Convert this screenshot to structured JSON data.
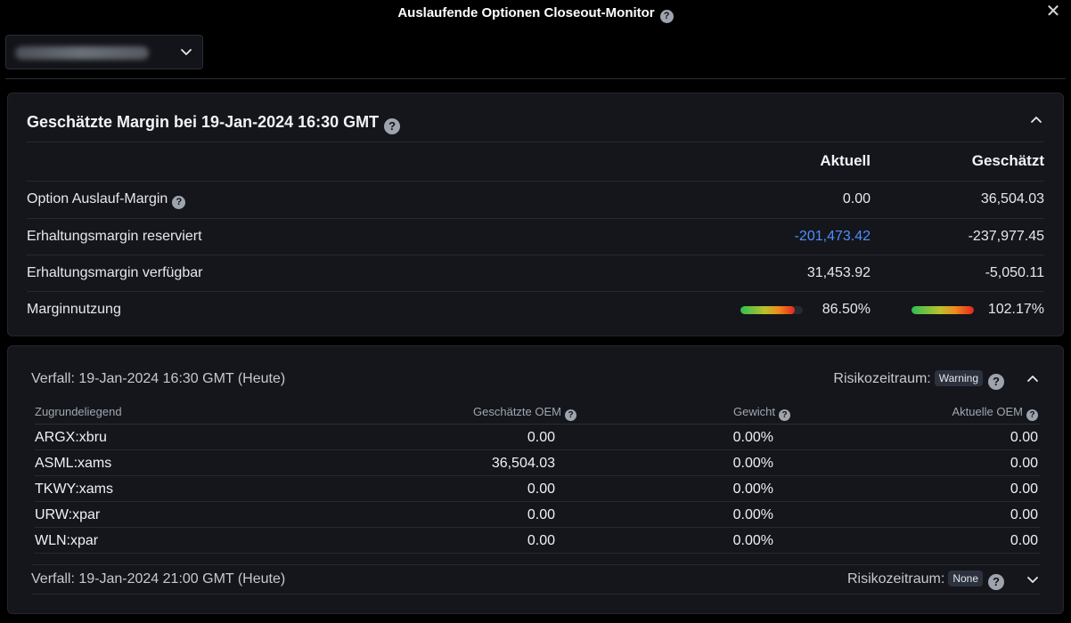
{
  "window": {
    "title": "Auslaufende Optionen Closeout-Monitor",
    "help_glyph": "?",
    "close_glyph": "✕"
  },
  "account_select": {
    "value": "",
    "icon": "chevron-down-icon"
  },
  "margin_panel": {
    "title": "Geschätzte Margin bei 19-Jan-2024 16:30 GMT",
    "columns": {
      "current": "Aktuell",
      "estimated": "Geschätzt"
    },
    "rows": [
      {
        "label": "Option Auslauf-Margin",
        "current": "0.00",
        "estimated": "36,504.03"
      },
      {
        "label": "Erhaltungsmargin reserviert",
        "current": "-201,473.42",
        "estimated": "-237,977.45"
      },
      {
        "label": "Erhaltungsmargin verfügbar",
        "current": "31,453.92",
        "estimated": "-5,050.11"
      },
      {
        "label": "Marginnutzung",
        "current": "86.50%",
        "estimated": "102.17%"
      }
    ],
    "utilization": {
      "current_fraction": 0.865,
      "estimated_fraction": 1.0
    },
    "colors": {
      "negative_highlight": "#4f8dff",
      "bar_start": "#2fbf52",
      "bar_end": "#e4261f"
    }
  },
  "expiry_panel": {
    "expiry1": {
      "title": "Verfall: 19-Jan-2024 16:30 GMT (Heute)",
      "risk_label": "Risikozeitraum:",
      "risk_badge": "Warning",
      "headers": {
        "underlying": "Zugrundeliegend",
        "est_oem": "Geschätzte OEM",
        "weight": "Gewicht",
        "current_oem": "Aktuelle OEM"
      },
      "rows": [
        {
          "underlying": "ARGX:xbru",
          "est_oem": "0.00",
          "weight": "0.00%",
          "current_oem": "0.00"
        },
        {
          "underlying": "ASML:xams",
          "est_oem": "36,504.03",
          "weight": "0.00%",
          "current_oem": "0.00"
        },
        {
          "underlying": "TKWY:xams",
          "est_oem": "0.00",
          "weight": "0.00%",
          "current_oem": "0.00"
        },
        {
          "underlying": "URW:xpar",
          "est_oem": "0.00",
          "weight": "0.00%",
          "current_oem": "0.00"
        },
        {
          "underlying": "WLN:xpar",
          "est_oem": "0.00",
          "weight": "0.00%",
          "current_oem": "0.00"
        }
      ]
    },
    "expiry2": {
      "title": "Verfall: 19-Jan-2024 21:00 GMT (Heute)",
      "risk_label": "Risikozeitraum:",
      "risk_badge": "None"
    }
  }
}
